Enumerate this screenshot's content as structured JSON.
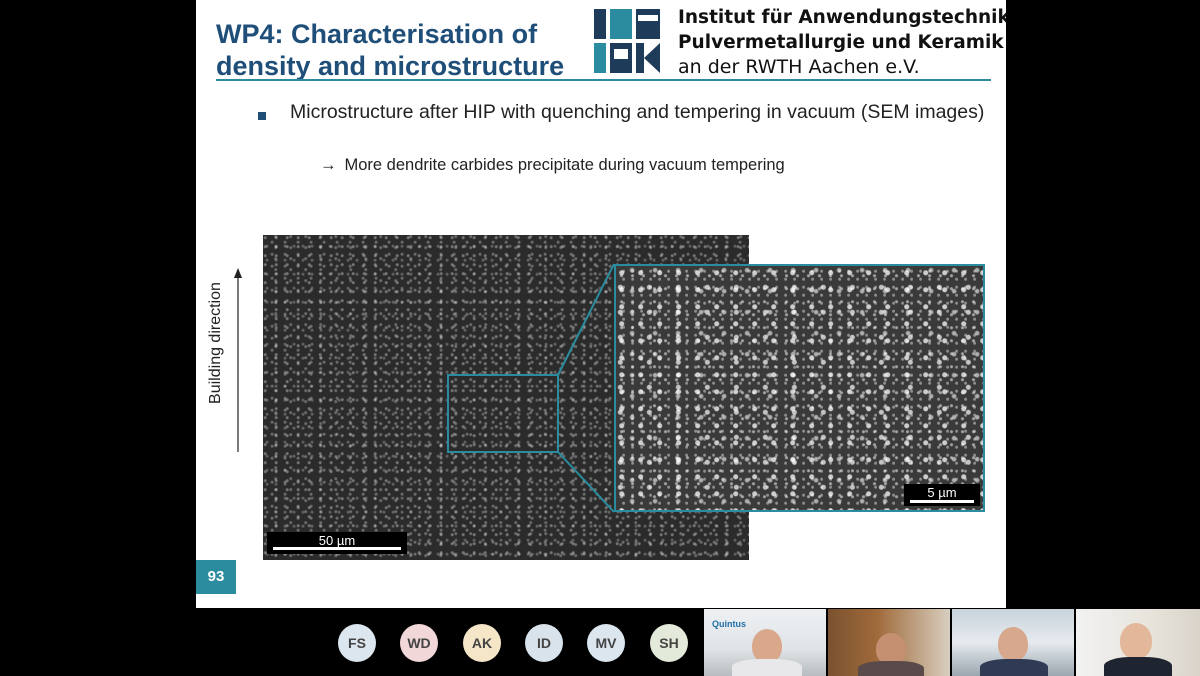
{
  "slide": {
    "title": "WP4: Characterisation of density and microstructure",
    "logo": {
      "line1": "Institut für Anwendungstechnik",
      "line2": "Pulvermetallurgie und Keramik",
      "line3": "an der RWTH Aachen e.V.",
      "letters": "IAPK",
      "color_dark": "#1f3b5a",
      "color_teal": "#2a8c9e"
    },
    "bullet_text": "Microstructure after HIP with quenching and tempering in vacuum (SEM images)",
    "sub_bullet_arrow": "→",
    "sub_bullet_text": "More dendrite carbides precipitate during vacuum tempering",
    "building_direction_label": "Building direction",
    "scale_main": "50 µm",
    "scale_zoom": "5 µm",
    "page_number": "93",
    "accent_color": "#2a8c9e",
    "title_color": "#1f4e79"
  },
  "participants": [
    {
      "initials": "FS",
      "color": "#dbe6ef"
    },
    {
      "initials": "WD",
      "color": "#f2d7d9"
    },
    {
      "initials": "AK",
      "color": "#f5e6c8"
    },
    {
      "initials": "ID",
      "color": "#d9e3ec"
    },
    {
      "initials": "MV",
      "color": "#dbe6ef"
    },
    {
      "initials": "SH",
      "color": "#e3ead9"
    }
  ],
  "video_tiles": [
    {
      "overlay_text": "Quintus"
    },
    {
      "overlay_text": ""
    },
    {
      "overlay_text": ""
    },
    {
      "overlay_text": ""
    }
  ]
}
